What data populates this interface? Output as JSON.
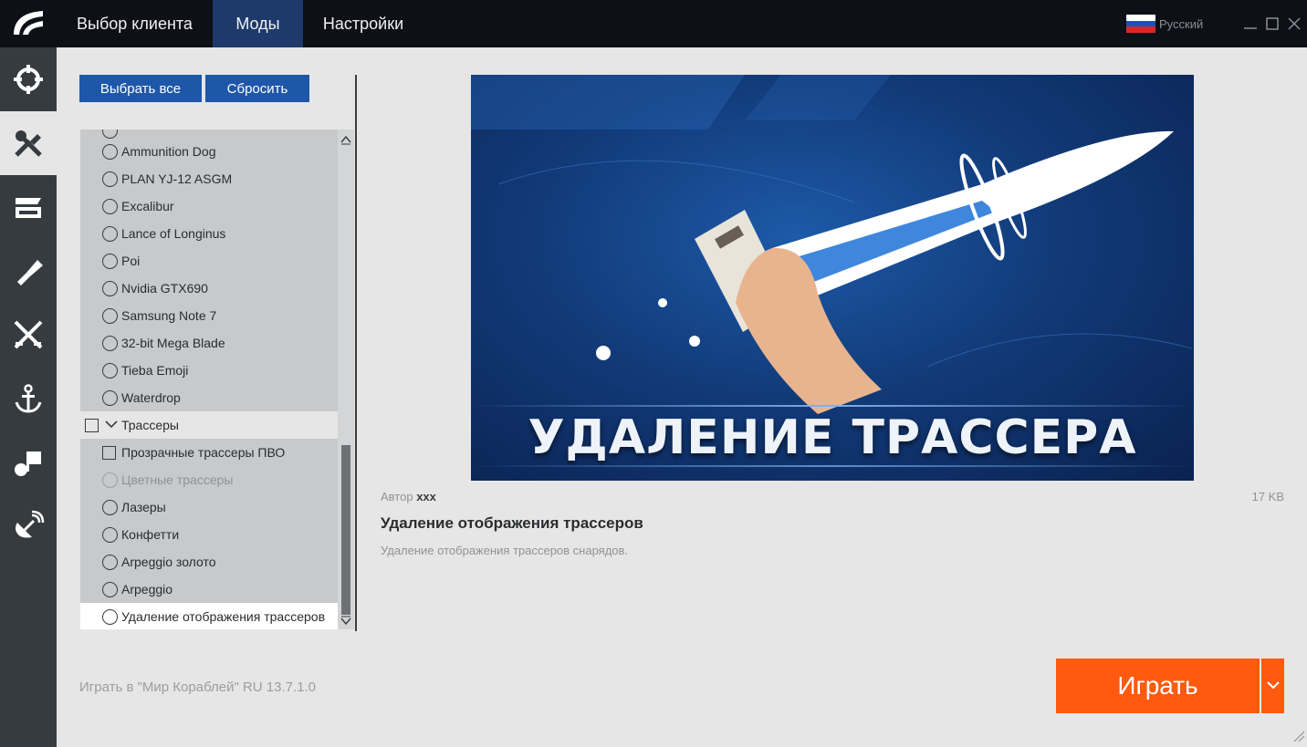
{
  "topbar": {
    "tabs": [
      {
        "label": "Выбор клиента",
        "active": false
      },
      {
        "label": "Моды",
        "active": true
      },
      {
        "label": "Настройки",
        "active": false
      }
    ],
    "language": "Русский",
    "window_controls": [
      "minimize-icon",
      "maximize-icon",
      "close-icon"
    ]
  },
  "rail": {
    "items": [
      {
        "icon": "crosshair-icon",
        "active": false
      },
      {
        "icon": "tools-icon",
        "active": true
      },
      {
        "icon": "clapperboard-icon",
        "active": false
      },
      {
        "icon": "brush-icon",
        "active": false
      },
      {
        "icon": "crossed-swords-icon",
        "active": false
      },
      {
        "icon": "anchor-icon",
        "active": false
      },
      {
        "icon": "flag-pin-icon",
        "active": false
      },
      {
        "icon": "satellite-icon",
        "active": false
      }
    ]
  },
  "actions": {
    "select_all": "Выбрать все",
    "reset": "Сбросить"
  },
  "mods_list": {
    "items": [
      {
        "label": "Ammunition Dog",
        "type": "radio"
      },
      {
        "label": "PLAN YJ-12 ASGM",
        "type": "radio"
      },
      {
        "label": "Excalibur",
        "type": "radio"
      },
      {
        "label": "Lance of Longinus",
        "type": "radio"
      },
      {
        "label": "Poi",
        "type": "radio"
      },
      {
        "label": "Nvidia GTX690",
        "type": "radio"
      },
      {
        "label": "Samsung Note 7",
        "type": "radio"
      },
      {
        "label": "32-bit Mega Blade",
        "type": "radio"
      },
      {
        "label": "Tieba Emoji",
        "type": "radio"
      },
      {
        "label": "Waterdrop",
        "type": "radio"
      },
      {
        "label": "Трассеры",
        "type": "group"
      },
      {
        "label": "Прозрачные трассеры ПВО",
        "type": "checkbox"
      },
      {
        "label": "Цветные трассеры",
        "type": "radio",
        "disabled": true
      },
      {
        "label": "Лазеры",
        "type": "radio"
      },
      {
        "label": "Конфетти",
        "type": "radio"
      },
      {
        "label": "Arpeggio золото",
        "type": "radio"
      },
      {
        "label": "Arpeggio",
        "type": "radio"
      },
      {
        "label": "Удаление отображения трассеров",
        "type": "radio",
        "selected": true
      }
    ]
  },
  "preview": {
    "banner_text": "УДАЛЕНИЕ ТРАССЕРА",
    "author_label": "Автор",
    "author": "xxx",
    "size": "17 KB",
    "title": "Удаление отображения трассеров",
    "description": "Удаление отображения трассеров снарядов."
  },
  "footer": {
    "game_label": "Играть в \"Мир Кораблей\" RU 13.7.1.0",
    "play_label": "Играть"
  },
  "colors": {
    "accent_blue": "#1e57a9",
    "play_orange": "#ff5a0f",
    "topbar": "#0d1017",
    "rail": "#363b40"
  }
}
